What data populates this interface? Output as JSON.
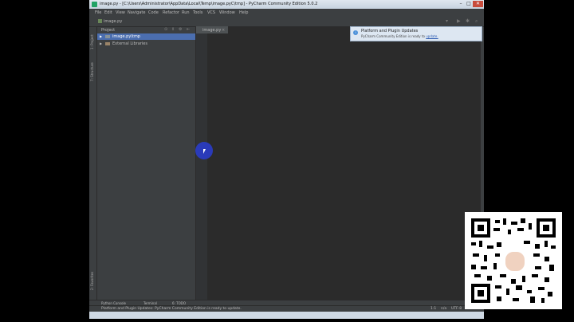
{
  "window": {
    "title": "image.py - [C:\\Users\\Administrator\\AppData\\Local\\Temp\\image.pyC\\tmp] - PyCharm Community Edition 5.0.2"
  },
  "menu": [
    "File",
    "Edit",
    "View",
    "Navigate",
    "Code",
    "Refactor",
    "Run",
    "Tools",
    "VCS",
    "Window",
    "Help"
  ],
  "navbar": {
    "file": "image.py"
  },
  "left_tabs": {
    "project": "1: Project",
    "structure": "7: Structure",
    "favorites": "2: Favorites"
  },
  "project_panel": {
    "header": "Project",
    "tree": [
      {
        "label": "image.py\\tmp",
        "selected": true
      },
      {
        "label": "External Libraries",
        "selected": false
      }
    ]
  },
  "editor": {
    "tab": "image.py"
  },
  "notification": {
    "title": "Platform and Plugin Updates",
    "body": "PyCharm Community Edition is ready to",
    "link": "update."
  },
  "bottom_tools": {
    "python_console": "Python Console",
    "terminal": "Terminal",
    "todo": "6: TODO"
  },
  "status": {
    "message": "Platform and Plugin Updates: PyCharm Community Edition is ready to update.",
    "position": "1:1",
    "na": "n/a",
    "encoding": "UTF-8"
  },
  "colors": {
    "ide_bg": "#3c3f41",
    "editor_bg": "#2b2b2b",
    "selection": "#4b6eaf",
    "cursor_highlight": "#2a3cc9"
  },
  "qr_code": {
    "icon": "qr-code-with-avatar"
  }
}
